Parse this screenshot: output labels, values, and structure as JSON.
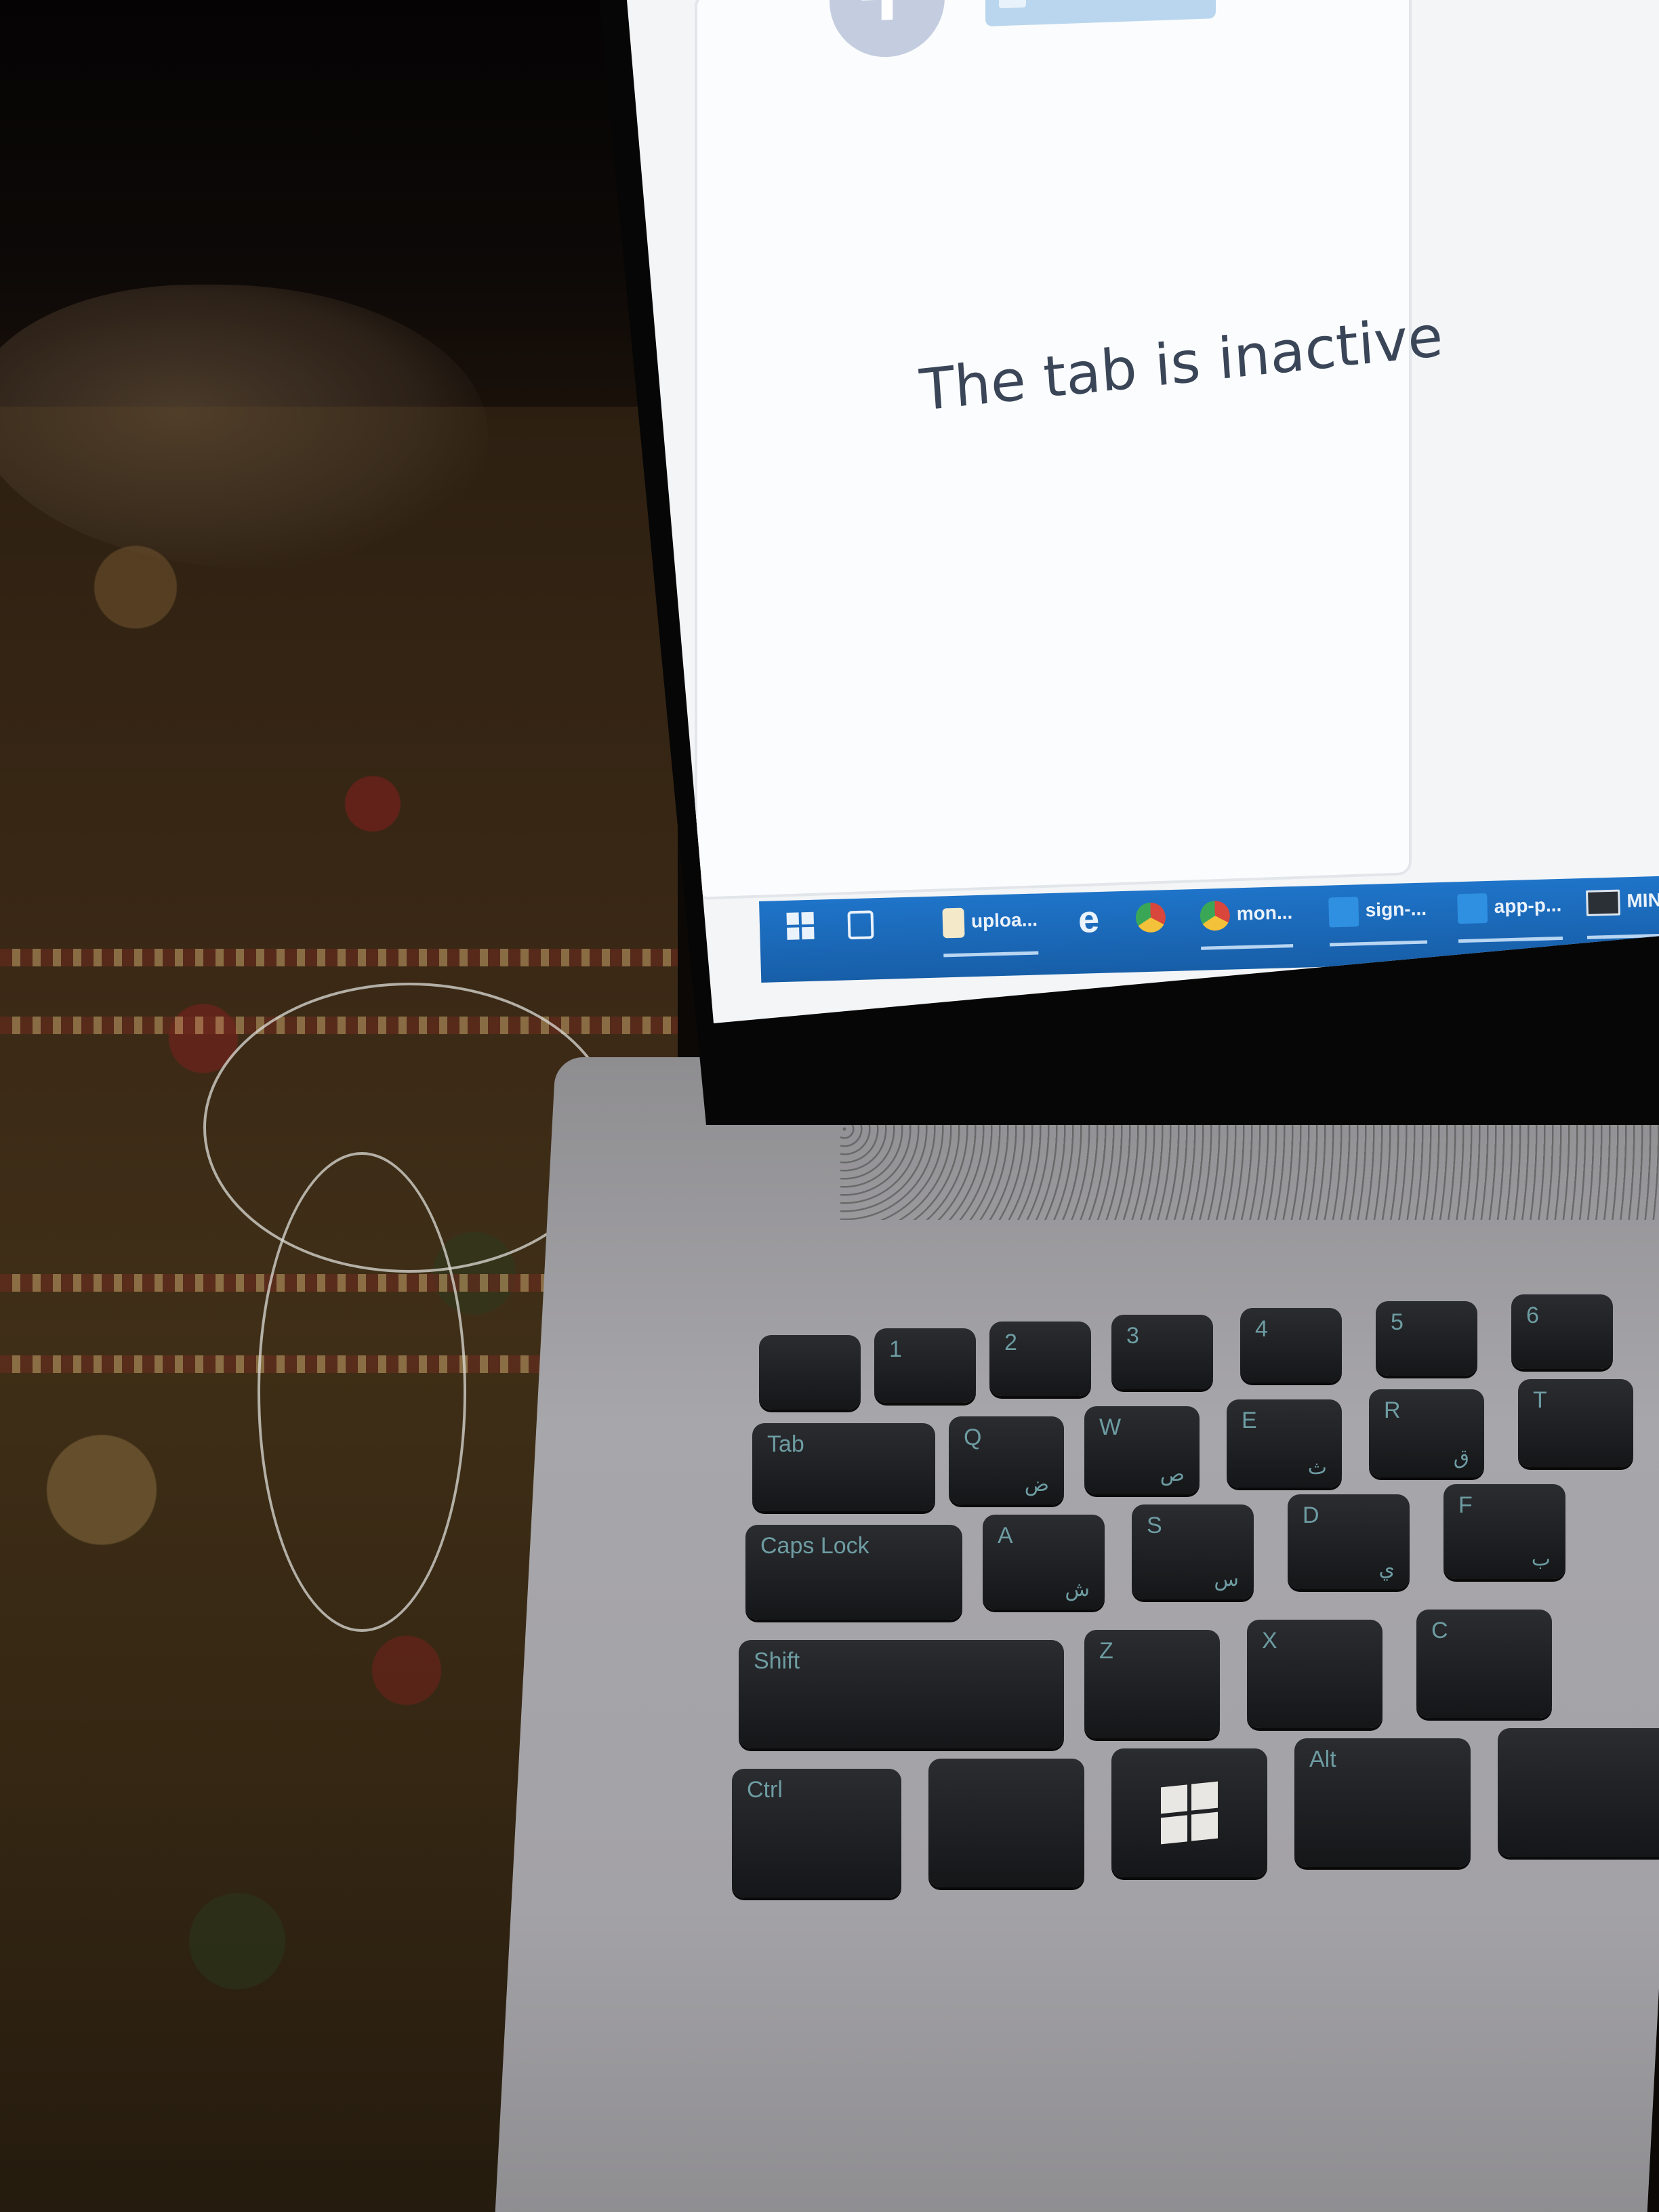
{
  "screen": {
    "message": "The tab is inactive"
  },
  "taskbar": {
    "items": [
      {
        "label": "uploa...",
        "icon": "file-icon"
      },
      {
        "label": "",
        "icon": "edge-icon"
      },
      {
        "label": "",
        "icon": "chrome-icon"
      },
      {
        "label": "mon...",
        "icon": "chrome-icon"
      },
      {
        "label": "sign-...",
        "icon": "vscode-icon"
      },
      {
        "label": "app-p...",
        "icon": "vscode-icon"
      },
      {
        "label": "MIN...",
        "icon": "window-icon"
      }
    ]
  },
  "keyboard": {
    "keys": {
      "tab": "Tab",
      "caps": "Caps Lock",
      "shift": "Shift",
      "ctrl": "Ctrl",
      "alt": "Alt",
      "q": "Q",
      "w": "W",
      "e": "E",
      "r": "R",
      "t": "T",
      "a": "A",
      "s": "S",
      "d": "D",
      "f": "F",
      "z": "Z",
      "x": "X",
      "c": "C",
      "n1": "1",
      "n2": "2",
      "n3": "3",
      "n4": "4",
      "n5": "5",
      "n6": "6",
      "q_ar": "ض",
      "w_ar": "ص",
      "e_ar": "ث",
      "r_ar": "ق",
      "a_ar": "ش",
      "s_ar": "س",
      "d_ar": "ي",
      "f_ar": "ب"
    }
  },
  "colors": {
    "taskbar": "#1f74c9",
    "screen_bg": "#f3f5f7",
    "text": "#3a4658"
  }
}
